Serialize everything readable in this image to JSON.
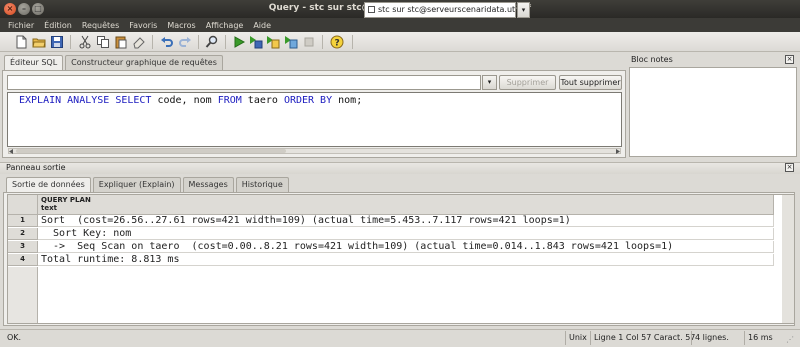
{
  "window": {
    "title": "Query - stc sur stc@serveurscenaridata.utc : 5432 *",
    "close_glyph": "×",
    "min_glyph": "–",
    "max_glyph": "□"
  },
  "menu": [
    "Fichier",
    "Édition",
    "Requêtes",
    "Favoris",
    "Macros",
    "Affichage",
    "Aide"
  ],
  "toolbar": {
    "icons": [
      "new-file-icon",
      "open-folder-icon",
      "save-icon",
      "cut-icon",
      "copy-icon",
      "paste-icon",
      "eraser-icon",
      "undo-icon",
      "redo-icon",
      "find-icon",
      "execute-icon",
      "execute-to-file-icon",
      "explain-icon",
      "stop-icon",
      "help-icon"
    ],
    "connection": "stc sur stc@serveurscenaridata.utc",
    "dropdown_glyph": "▾"
  },
  "editor": {
    "tabs": [
      "Éditeur SQL",
      "Constructeur graphique de requêtes"
    ],
    "history_dropdown_glyph": "▾",
    "delete_label": "Supprimer",
    "delete_all_label": "Tout supprimer",
    "sql": {
      "kw1": "EXPLAIN ANALYSE SELECT",
      "t1": " code, nom ",
      "kw2": "FROM",
      "t2": " taero ",
      "kw3": "ORDER BY",
      "t3": " nom;"
    }
  },
  "notes": {
    "title": "Bloc notes",
    "close_glyph": "×"
  },
  "output": {
    "title": "Panneau sortie",
    "close_glyph": "×",
    "tabs": [
      "Sortie de données",
      "Expliquer (Explain)",
      "Messages",
      "Historique"
    ],
    "column": {
      "name": "QUERY PLAN",
      "type": "text"
    },
    "rows": [
      {
        "num": "1",
        "text": "Sort  (cost=26.56..27.61 rows=421 width=109) (actual time=5.453..7.117 rows=421 loops=1)"
      },
      {
        "num": "2",
        "text": "  Sort Key: nom"
      },
      {
        "num": "3",
        "text": "  ->  Seq Scan on taero  (cost=0.00..8.21 rows=421 width=109) (actual time=0.014..1.843 rows=421 loops=1)"
      },
      {
        "num": "4",
        "text": "Total runtime: 8.813 ms"
      }
    ]
  },
  "status": {
    "message": "OK.",
    "encoding": "Unix",
    "position": "Ligne 1 Col 57 Caract. 57",
    "rows": "4 lignes.",
    "time": "16 ms",
    "grip_glyph": "⋰"
  }
}
